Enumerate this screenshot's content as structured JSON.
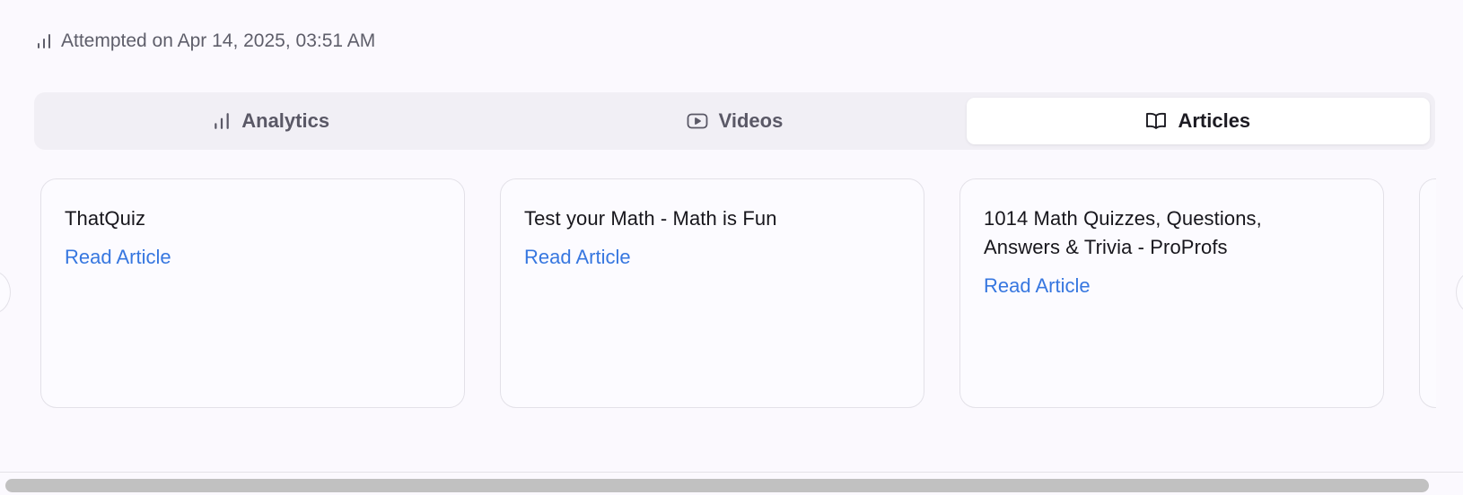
{
  "attempt": {
    "icon": "bar-chart-icon",
    "text": "Attempted on Apr 14, 2025, 03:51 AM"
  },
  "tabs": [
    {
      "label": "Analytics",
      "icon": "bar-chart-icon",
      "active": false
    },
    {
      "label": "Videos",
      "icon": "play-video-icon",
      "active": false
    },
    {
      "label": "Articles",
      "icon": "open-book-icon",
      "active": true
    }
  ],
  "articles": [
    {
      "title": "ThatQuiz",
      "link": "Read Article"
    },
    {
      "title": "Test your Math - Math is Fun",
      "link": "Read Article"
    },
    {
      "title": "1014 Math Quizzes, Questions, Answers & Trivia - ProProfs",
      "link": "Read Article"
    }
  ],
  "colors": {
    "background": "#fbf9fe",
    "tab_bar": "#f1eff5",
    "link": "#3777e0",
    "card_border": "#e3e1e8"
  }
}
